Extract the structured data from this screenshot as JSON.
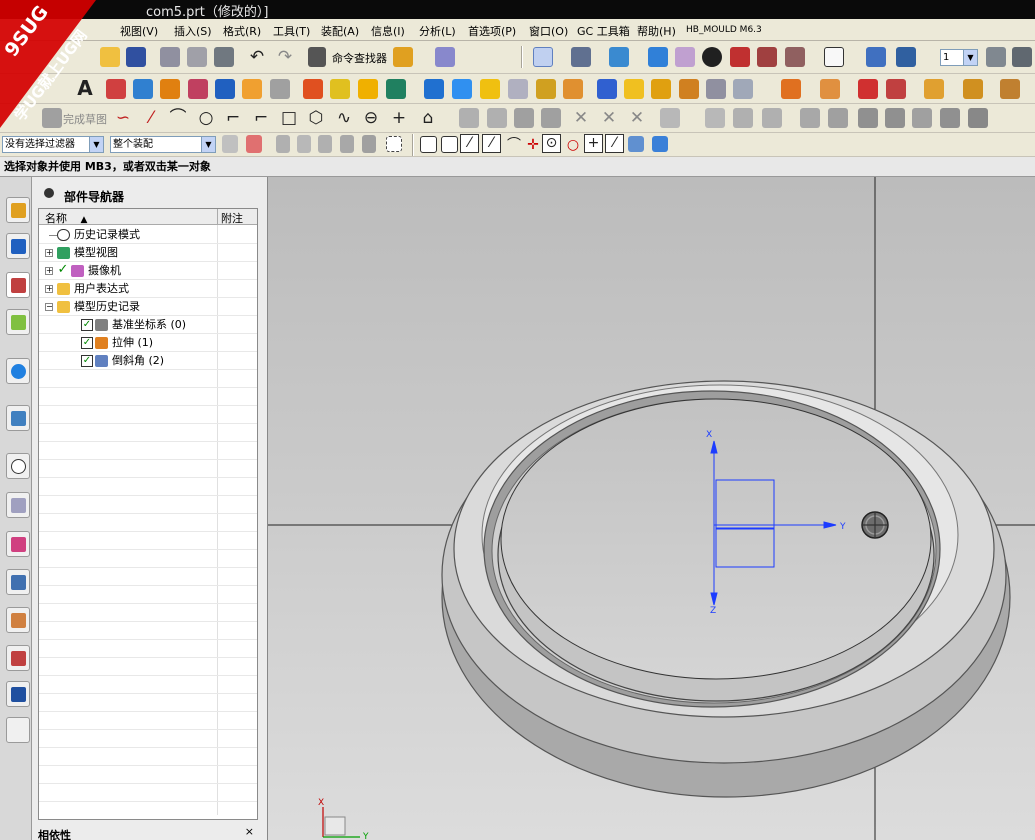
{
  "titlebar": {
    "title": "com5.prt（修改的）]"
  },
  "menubar": {
    "items": [
      "视图(V)",
      "插入(S)",
      "格式(R)",
      "工具(T)",
      "装配(A)",
      "信息(I)",
      "分析(L)",
      "首选项(P)",
      "窗口(O)",
      "GC 工具箱",
      "帮助(H)",
      "HB_MOULD M6.3"
    ]
  },
  "toolbar": {
    "command_finder": "命令查找器",
    "layer_value": "1",
    "finish_sketch": "完成草图"
  },
  "selection_bar": {
    "filter": "没有选择过滤器",
    "scope": "整个装配"
  },
  "status": {
    "message": "选择对象并使用 MB3，或者双击某一对象"
  },
  "navigator": {
    "title": "部件导航器",
    "columns": [
      "名称",
      "附注"
    ],
    "sort_marker": "▲",
    "nodes": [
      {
        "label": "历史记录模式",
        "icon": "clock-icon",
        "depth": 0,
        "expander": "",
        "checked": false
      },
      {
        "label": "模型视图",
        "icon": "model-views-icon",
        "depth": 0,
        "expander": "+",
        "checked": false
      },
      {
        "label": "摄像机",
        "icon": "camera-icon",
        "depth": 0,
        "expander": "+",
        "checked": true
      },
      {
        "label": "用户表达式",
        "icon": "folder-icon",
        "depth": 0,
        "expander": "+",
        "checked": false
      },
      {
        "label": "模型历史记录",
        "icon": "folder-open-icon",
        "depth": 0,
        "expander": "−",
        "checked": false
      },
      {
        "label": "基准坐标系 (0)",
        "icon": "datum-csys-icon",
        "depth": 1,
        "expander": "",
        "checked": true
      },
      {
        "label": "拉伸 (1)",
        "icon": "extrude-icon",
        "depth": 1,
        "expander": "",
        "checked": true
      },
      {
        "label": "倒斜角 (2)",
        "icon": "chamfer-icon",
        "depth": 1,
        "expander": "",
        "checked": true
      }
    ],
    "details_title": "相依性",
    "details_close": "×"
  },
  "graphics": {
    "csys_axes": [
      "X",
      "Y",
      "Z"
    ],
    "triad_axes": [
      "X",
      "Y"
    ]
  },
  "watermark": {
    "line1": "9SUG",
    "line2": "学UG就上UG网"
  },
  "colors": {
    "wcs": "#1c3cff",
    "accent": "#d40000"
  }
}
